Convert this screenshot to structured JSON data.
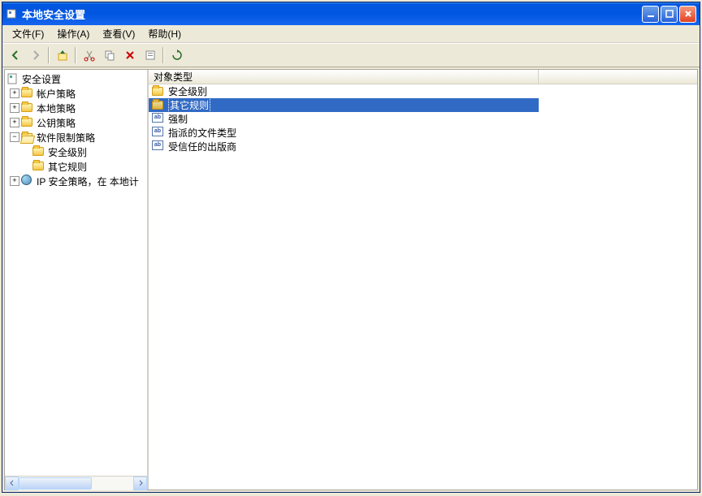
{
  "window": {
    "title": "本地安全设置"
  },
  "menu": {
    "file": "文件(F)",
    "action": "操作(A)",
    "view": "查看(V)",
    "help": "帮助(H)"
  },
  "tree": {
    "root": "安全设置",
    "items": [
      {
        "label": "帐户策略",
        "expanded": false
      },
      {
        "label": "本地策略",
        "expanded": false
      },
      {
        "label": "公钥策略",
        "expanded": false
      },
      {
        "label": "软件限制策略",
        "expanded": true,
        "children": [
          {
            "label": "安全级别"
          },
          {
            "label": "其它规则"
          }
        ]
      },
      {
        "label": "IP 安全策略，在 本地计",
        "expanded": false
      }
    ]
  },
  "list": {
    "column": "对象类型",
    "items": [
      {
        "label": "安全级别",
        "icon": "folder",
        "selected": false
      },
      {
        "label": "其它规则",
        "icon": "folder",
        "selected": true
      },
      {
        "label": "强制",
        "icon": "reg",
        "selected": false
      },
      {
        "label": "指派的文件类型",
        "icon": "reg",
        "selected": false
      },
      {
        "label": "受信任的出版商",
        "icon": "reg",
        "selected": false
      }
    ]
  }
}
